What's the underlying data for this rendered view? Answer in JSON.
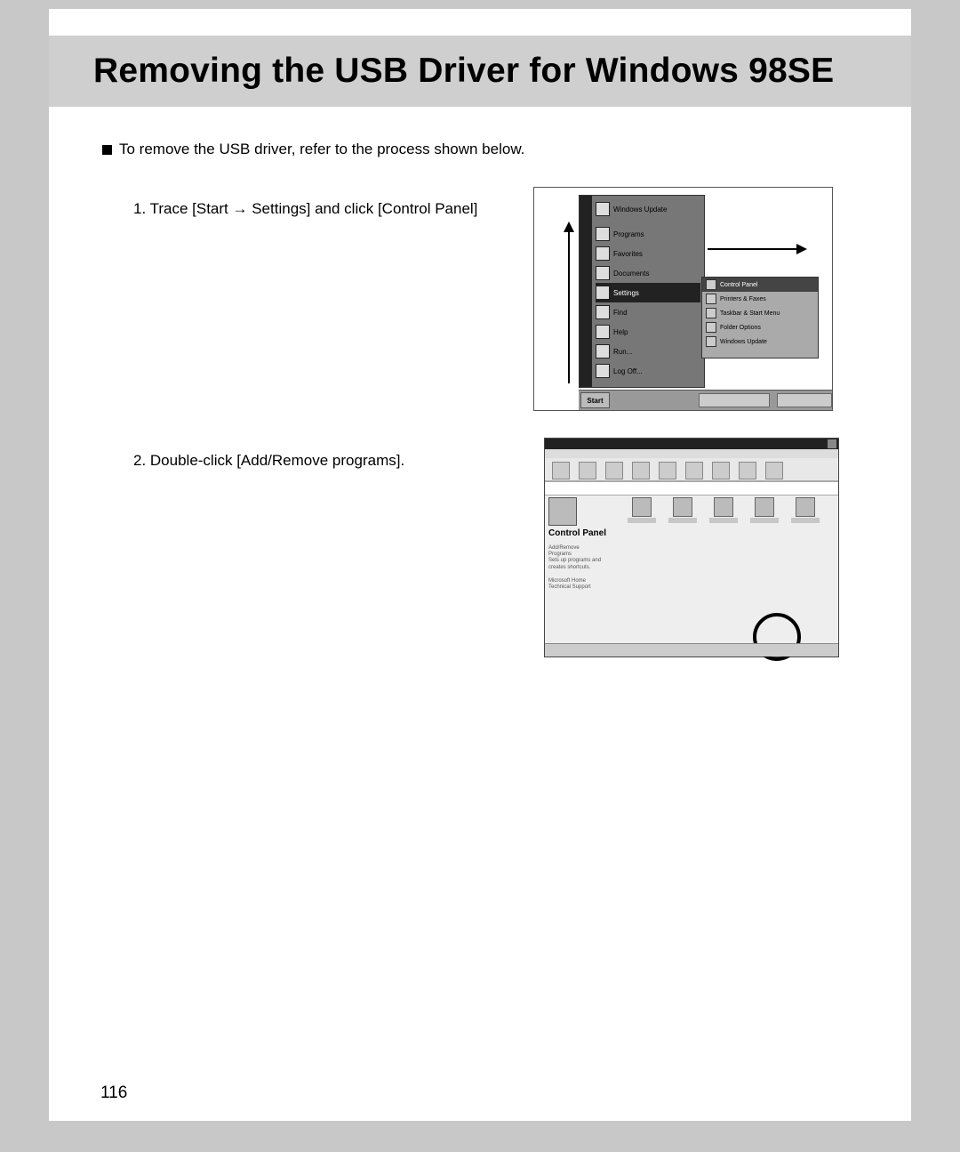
{
  "page": {
    "title": "Removing the USB Driver for Windows 98SE",
    "intro": "To remove the USB driver, refer to the process shown below.",
    "step1_prefix": "1. Trace [Start ",
    "step1_arrow": "→",
    "step1_suffix": " Settings] and click [Control Panel]",
    "step2": "2. Double-click [Add/Remove programs].",
    "page_number": "116"
  },
  "fig1": {
    "start_menu_items": [
      "Windows Update",
      "Programs",
      "Favorites",
      "Documents",
      "Settings",
      "Find",
      "Help",
      "Run...",
      "Log Off..."
    ],
    "selected_item": "Settings",
    "submenu_items": [
      "Control Panel",
      "Printers & Faxes",
      "Taskbar & Start Menu",
      "Folder Options",
      "Windows Update"
    ],
    "submenu_selected": "Control Panel",
    "taskbar_start": "Start"
  },
  "fig2": {
    "left_title": "Control Panel",
    "circled_label": "Add/Remove Programs"
  }
}
